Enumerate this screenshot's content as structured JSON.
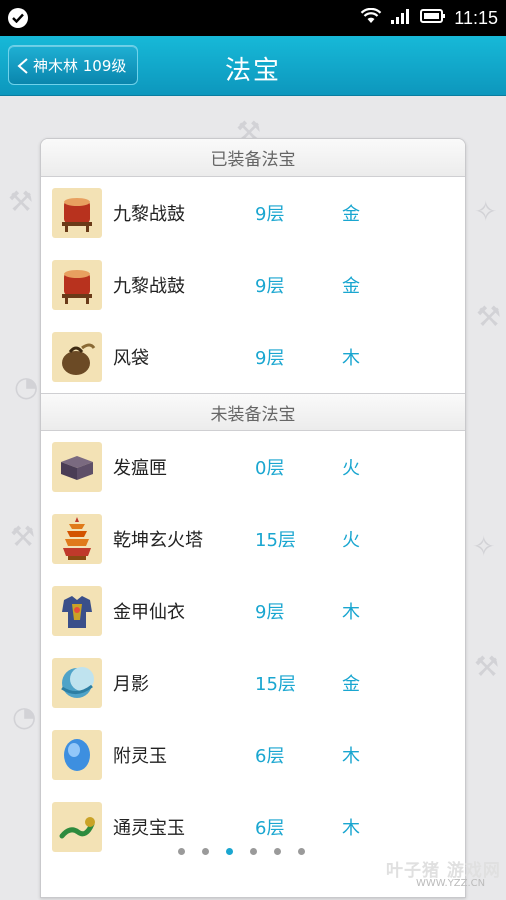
{
  "status_bar": {
    "time": "11:15"
  },
  "header": {
    "back_label": "神木林 109级",
    "title": "法宝"
  },
  "sections": [
    {
      "title": "已装备法宝",
      "items": [
        {
          "name": "九黎战鼓",
          "level": "9层",
          "element": "金",
          "icon": "war-drum-icon"
        },
        {
          "name": "九黎战鼓",
          "level": "9层",
          "element": "金",
          "icon": "war-drum-icon"
        },
        {
          "name": "风袋",
          "level": "9层",
          "element": "木",
          "icon": "wind-bag-icon"
        }
      ]
    },
    {
      "title": "未装备法宝",
      "items": [
        {
          "name": "发瘟匣",
          "level": "0层",
          "element": "火",
          "icon": "plague-box-icon"
        },
        {
          "name": "乾坤玄火塔",
          "level": "15层",
          "element": "火",
          "icon": "fire-pagoda-icon"
        },
        {
          "name": "金甲仙衣",
          "level": "9层",
          "element": "木",
          "icon": "golden-armor-icon"
        },
        {
          "name": "月影",
          "level": "15层",
          "element": "金",
          "icon": "moon-shadow-icon"
        },
        {
          "name": "附灵玉",
          "level": "6层",
          "element": "木",
          "icon": "spirit-jade-icon"
        },
        {
          "name": "通灵宝玉",
          "level": "6层",
          "element": "木",
          "icon": "jade-dragon-icon"
        }
      ]
    }
  ],
  "pagination": {
    "count": 6,
    "active": 2
  },
  "watermark": {
    "main": "叶子猪 游戏网",
    "sub": "WWW.YZZ.CN"
  }
}
